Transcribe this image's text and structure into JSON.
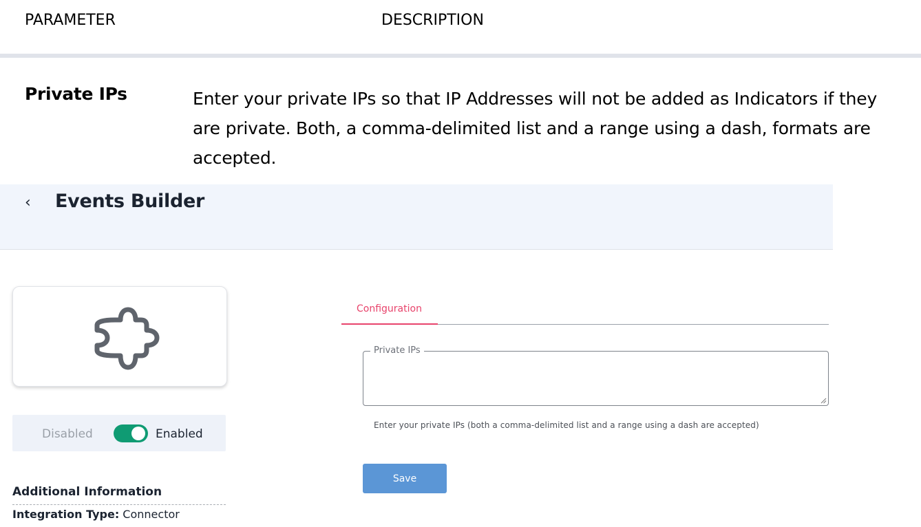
{
  "doc_table": {
    "col_parameter": "PARAMETER",
    "col_description": "DESCRIPTION",
    "row": {
      "name": "Private IPs",
      "description": "Enter your private IPs so that IP Addresses will not be added as Indicators if they are private.  Both, a comma-delimited list and a range using a dash, formats are accepted."
    }
  },
  "app": {
    "back_glyph": "‹",
    "title": "Events Builder",
    "icon": "puzzle-piece-icon",
    "toggle": {
      "off_label": "Disabled",
      "on_label": "Enabled",
      "state": "on",
      "color": "#0f9b73"
    },
    "additional_info": {
      "heading": "Additional Information",
      "integration_type_label": "Integration Type:",
      "integration_type_value": " Connector"
    },
    "tabs": [
      {
        "label": "Configuration",
        "active": true,
        "color": "#e8436b"
      }
    ],
    "private_ips_field": {
      "label": "Private IPs",
      "value": "",
      "helper": "Enter your private IPs (both a comma-delimited list and a range using a dash are accepted)"
    },
    "save_label": "Save",
    "save_color": "#5b96d6"
  }
}
